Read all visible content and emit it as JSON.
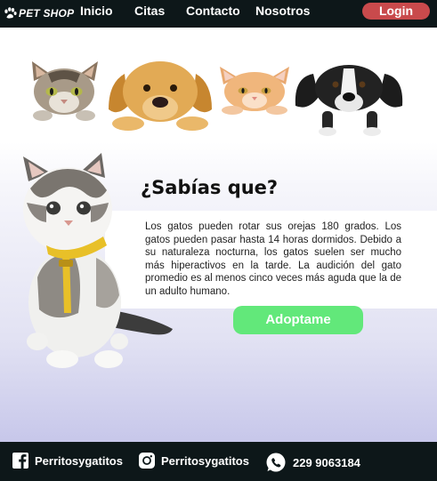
{
  "colors": {
    "nav_bg": "#0d1719",
    "login_bg": "#c94a4c",
    "adopt_bg": "#62e87a",
    "text_dark": "#111111"
  },
  "nav": {
    "brand": "PET SHOP",
    "links": [
      "Inicio",
      "Citas",
      "Contacto",
      "Nosotros"
    ],
    "login_label": "Login"
  },
  "main": {
    "title": "¿Sabías que?",
    "paragraph": "Los gatos pueden rotar sus orejas 180 grados. Los gatos pueden pasar hasta 14 horas dormidos. Debido a su naturaleza nocturna, los gatos suelen ser mucho más hiperactivos en la tarde. La audición del gato promedio es al menos cinco veces más aguda que la de un adulto humano.",
    "adopt_label": "Adoptame"
  },
  "footer": {
    "facebook": {
      "icon": "facebook-icon",
      "label": "Perritosygatitos"
    },
    "instagram": {
      "icon": "instagram-icon",
      "label": "Perritosygatitos"
    },
    "phone": {
      "icon": "whatsapp-icon",
      "label": "229 9063184"
    }
  }
}
